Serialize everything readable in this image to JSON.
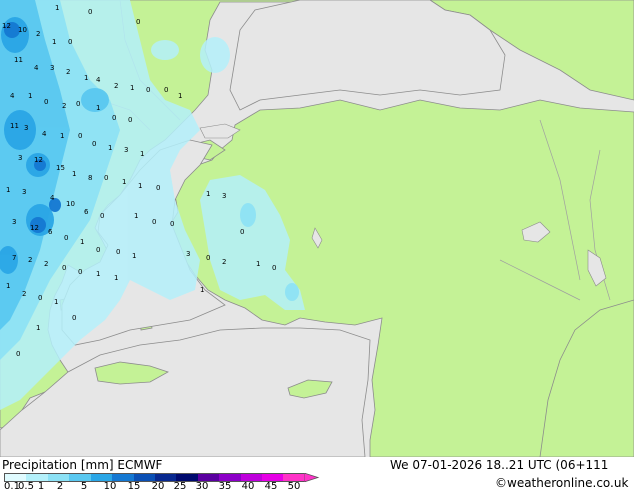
{
  "footer": {
    "title": "Precipitation [mm] ECMWF",
    "datetime": "We 07-01-2026 18..21 UTC (06+111",
    "credit": "©weatheronline.co.uk"
  },
  "colorbar": {
    "labels": [
      "0.1",
      "0.5",
      "1",
      "2",
      "5",
      "10",
      "15",
      "20",
      "25",
      "30",
      "35",
      "40",
      "45",
      "50"
    ],
    "colors": [
      "#e0fbff",
      "#b4f0fa",
      "#8ce1f5",
      "#5ac8f0",
      "#2aa6e6",
      "#1478d2",
      "#0a4fb4",
      "#08288f",
      "#000a6e",
      "#5a00a0",
      "#8c00c8",
      "#be00dc",
      "#e600e6",
      "#ff32c8"
    ]
  },
  "map": {
    "colors": {
      "sea": "#e6e6e6",
      "land": "#c4f296",
      "border": "#a0a0a0",
      "coast": "#8c8c8c"
    },
    "values": [
      "12",
      "10",
      "2",
      "1",
      "0",
      "0",
      "1",
      "0",
      "11",
      "4",
      "3",
      "2",
      "1",
      "4",
      "2",
      "1",
      "0",
      "0",
      "1",
      "4",
      "1",
      "0",
      "2",
      "0",
      "1",
      "0",
      "0",
      "11",
      "3",
      "4",
      "1",
      "0",
      "0",
      "1",
      "3",
      "1",
      "3",
      "12",
      "15",
      "1",
      "8",
      "0",
      "1",
      "1",
      "0",
      "1",
      "3",
      "1",
      "3",
      "4",
      "10",
      "6",
      "0",
      "1",
      "0",
      "0",
      "3",
      "12",
      "6",
      "0",
      "1",
      "0",
      "0",
      "1",
      "7",
      "2",
      "2",
      "0",
      "0",
      "1",
      "1",
      "1",
      "2",
      "0",
      "1",
      "0",
      "1",
      "3",
      "0",
      "2",
      "1",
      "0",
      "0",
      "1",
      "0"
    ]
  }
}
